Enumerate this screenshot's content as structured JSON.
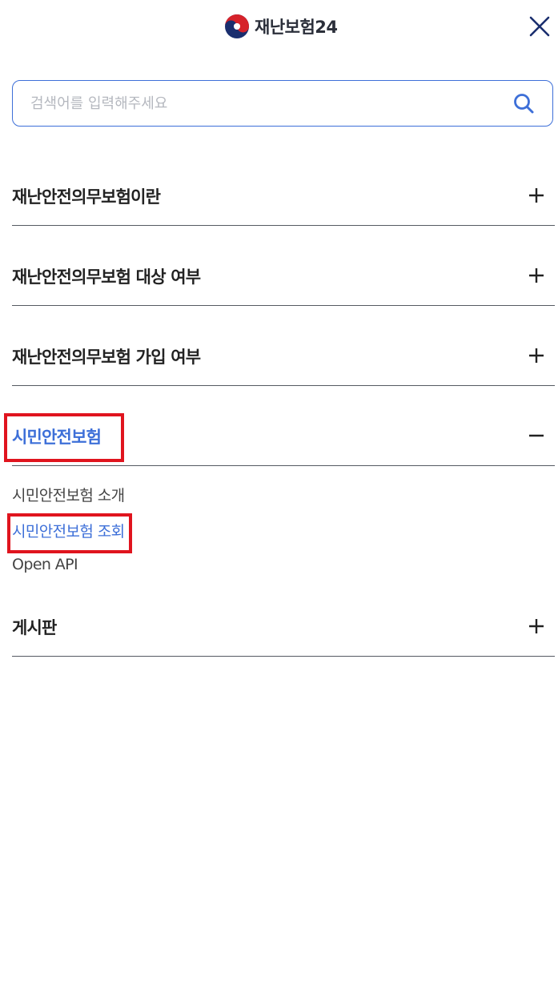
{
  "header": {
    "logo_text": "재난보험24",
    "logo_icon": "taegeuk-emblem-icon",
    "close_icon": "close-icon"
  },
  "search": {
    "placeholder": "검색어를 입력해주세요",
    "value": "",
    "icon": "search-icon"
  },
  "menu": {
    "items": [
      {
        "label": "재난안전의무보험이란",
        "toggle": "+"
      },
      {
        "label": "재난안전의무보험 대상 여부",
        "toggle": "+"
      },
      {
        "label": "재난안전의무보험 가입 여부",
        "toggle": "+"
      },
      {
        "label": "시민안전보험",
        "toggle": "−",
        "expanded": true,
        "sub_items": [
          {
            "label": "시민안전보험 소개",
            "active": false
          },
          {
            "label": "시민안전보험 조회",
            "active": true
          },
          {
            "label": "Open API",
            "active": false
          }
        ]
      },
      {
        "label": "게시판",
        "toggle": "+"
      }
    ]
  },
  "colors": {
    "accent": "#3d6fd8",
    "highlight": "#e0141e",
    "divider": "#555a62"
  }
}
